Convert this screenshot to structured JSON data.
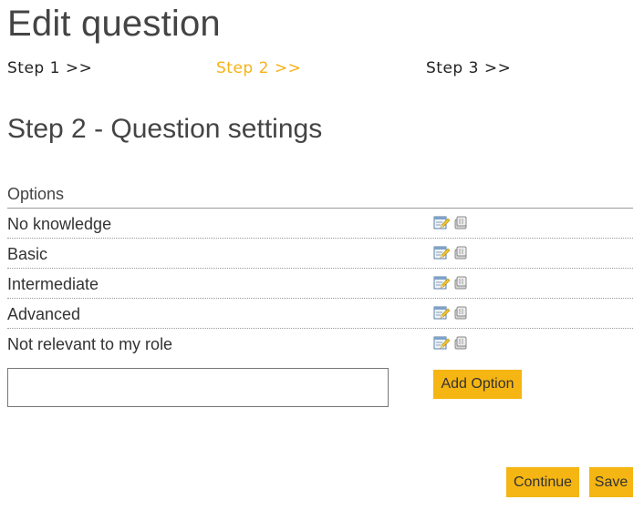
{
  "page": {
    "title": "Edit question"
  },
  "steps": [
    {
      "label": "Step 1 >>",
      "active": false
    },
    {
      "label": "Step 2 >>",
      "active": true
    },
    {
      "label": "Step 3 >>",
      "active": false
    }
  ],
  "section": {
    "title": "Step 2 - Question settings"
  },
  "options": {
    "header": "Options",
    "items": [
      {
        "label": "No knowledge",
        "icons": [
          "edit-icon",
          "delete-icon"
        ]
      },
      {
        "label": "Basic",
        "icons": [
          "edit-icon",
          "delete-icon"
        ]
      },
      {
        "label": "Intermediate",
        "icons": [
          "edit-icon",
          "delete-icon"
        ]
      },
      {
        "label": "Advanced",
        "icons": [
          "edit-icon",
          "delete-icon"
        ]
      },
      {
        "label": "Not relevant to my role",
        "icons": [
          "edit-icon",
          "delete-icon"
        ]
      }
    ]
  },
  "new_option": {
    "value": "",
    "add_label": "Add Option"
  },
  "actions": {
    "continue_label": "Continue",
    "save_label": "Save"
  },
  "colors": {
    "accent": "#f5b512",
    "active_step": "#f5b117"
  }
}
